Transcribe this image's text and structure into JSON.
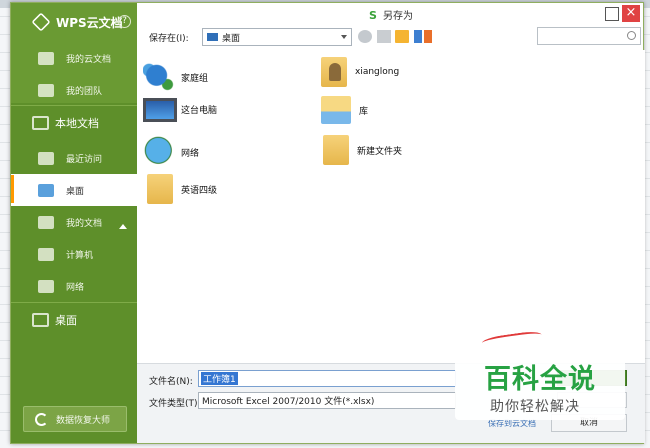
{
  "dialog": {
    "title": "另存为",
    "title_icon": "S"
  },
  "sidebar": {
    "brand": "WPS云文档",
    "help": "?",
    "items": [
      {
        "label": "我的云文档"
      },
      {
        "label": "我的团队"
      },
      {
        "label": "本地文档"
      },
      {
        "label": "最近访问"
      },
      {
        "label": "桌面"
      },
      {
        "label": "我的文档"
      },
      {
        "label": "计算机"
      },
      {
        "label": "网络"
      },
      {
        "label": "桌面"
      }
    ],
    "recover_button": "数据恢复大师"
  },
  "toolbar": {
    "save_in_label": "保存在(I):",
    "location": "桌面"
  },
  "files": [
    {
      "name": "家庭组",
      "icon": "homegroup-icon"
    },
    {
      "name": "xianglong",
      "icon": "user-folder-icon"
    },
    {
      "name": "这台电脑",
      "icon": "computer-icon"
    },
    {
      "name": "库",
      "icon": "library-icon"
    },
    {
      "name": "网络",
      "icon": "network-icon"
    },
    {
      "name": "新建文件夹",
      "icon": "folder-icon"
    },
    {
      "name": "英语四级",
      "icon": "folder-icon"
    }
  ],
  "form": {
    "filename_label": "文件名(N):",
    "filename_value": "工作簿1",
    "filetype_label": "文件类型(T):",
    "filetype_value": "Microsoft Excel 2007/2010 文件(*.xlsx)",
    "cancel_label": "取消",
    "cloud_link": "保存到云文档"
  },
  "watermark": {
    "big": "百科全说",
    "small": "助你轻松解决"
  },
  "colors": {
    "sidebar": "#5e8f2a",
    "accent": "#ff9900",
    "save_button": "#4d8a2a",
    "watermark_text": "#27a243"
  }
}
